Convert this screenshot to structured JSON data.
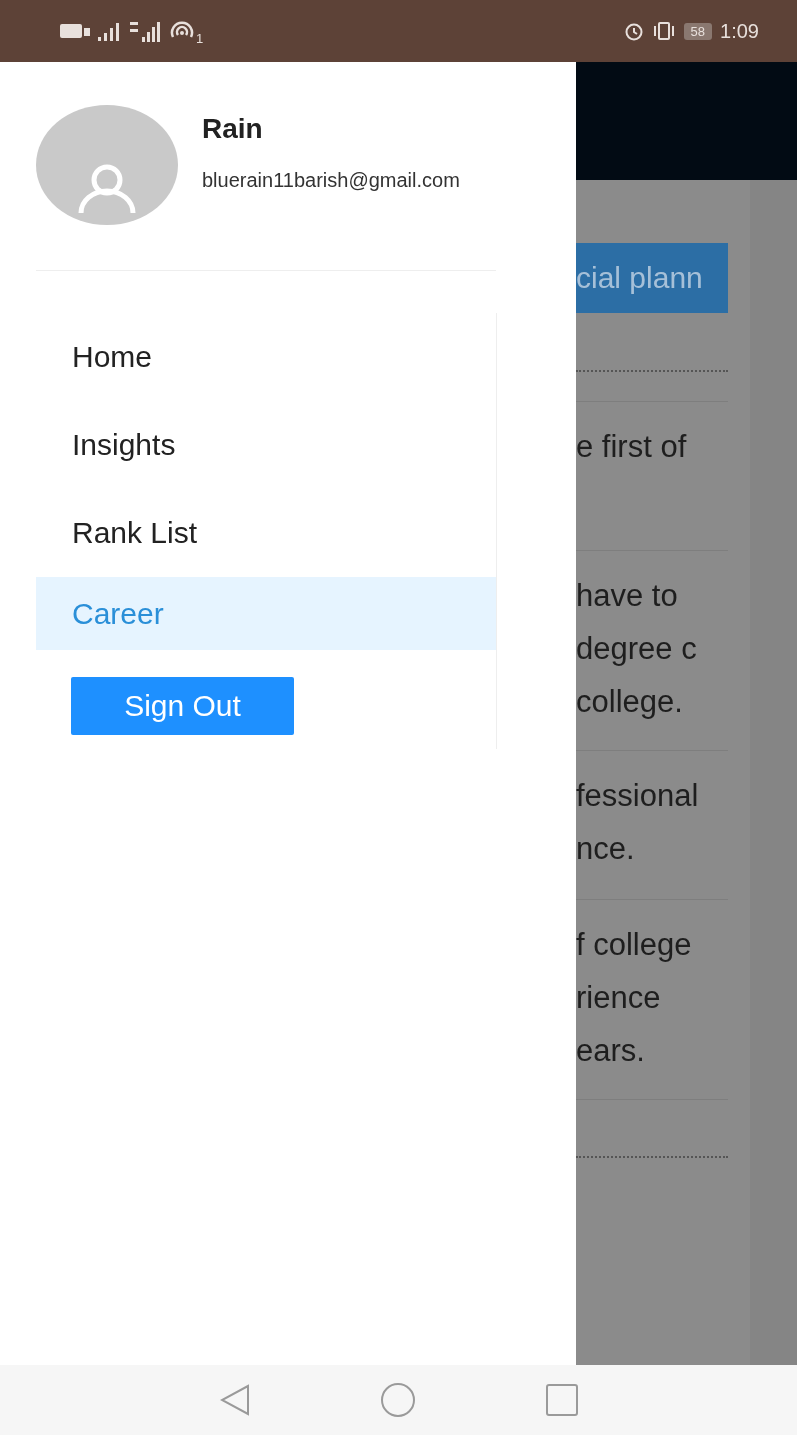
{
  "status_bar": {
    "sim_superscript": "1",
    "battery": "58",
    "time": "1:09"
  },
  "drawer": {
    "user": {
      "name": "Rain",
      "email": "bluerain11barish@gmail.com"
    },
    "menu": [
      {
        "label": "Home",
        "selected": false
      },
      {
        "label": "Insights",
        "selected": false
      },
      {
        "label": "Rank List",
        "selected": false
      },
      {
        "label": "Career",
        "selected": true
      }
    ],
    "sign_out": "Sign Out"
  },
  "background_page": {
    "button": "cial plann",
    "items": [
      {
        "lines": [
          "e first of"
        ]
      },
      {
        "lines": [
          "have to",
          "degree c",
          "college."
        ]
      },
      {
        "lines": [
          "fessional",
          "nce."
        ]
      },
      {
        "lines": [
          "f college",
          "rience",
          "ears."
        ]
      }
    ]
  }
}
